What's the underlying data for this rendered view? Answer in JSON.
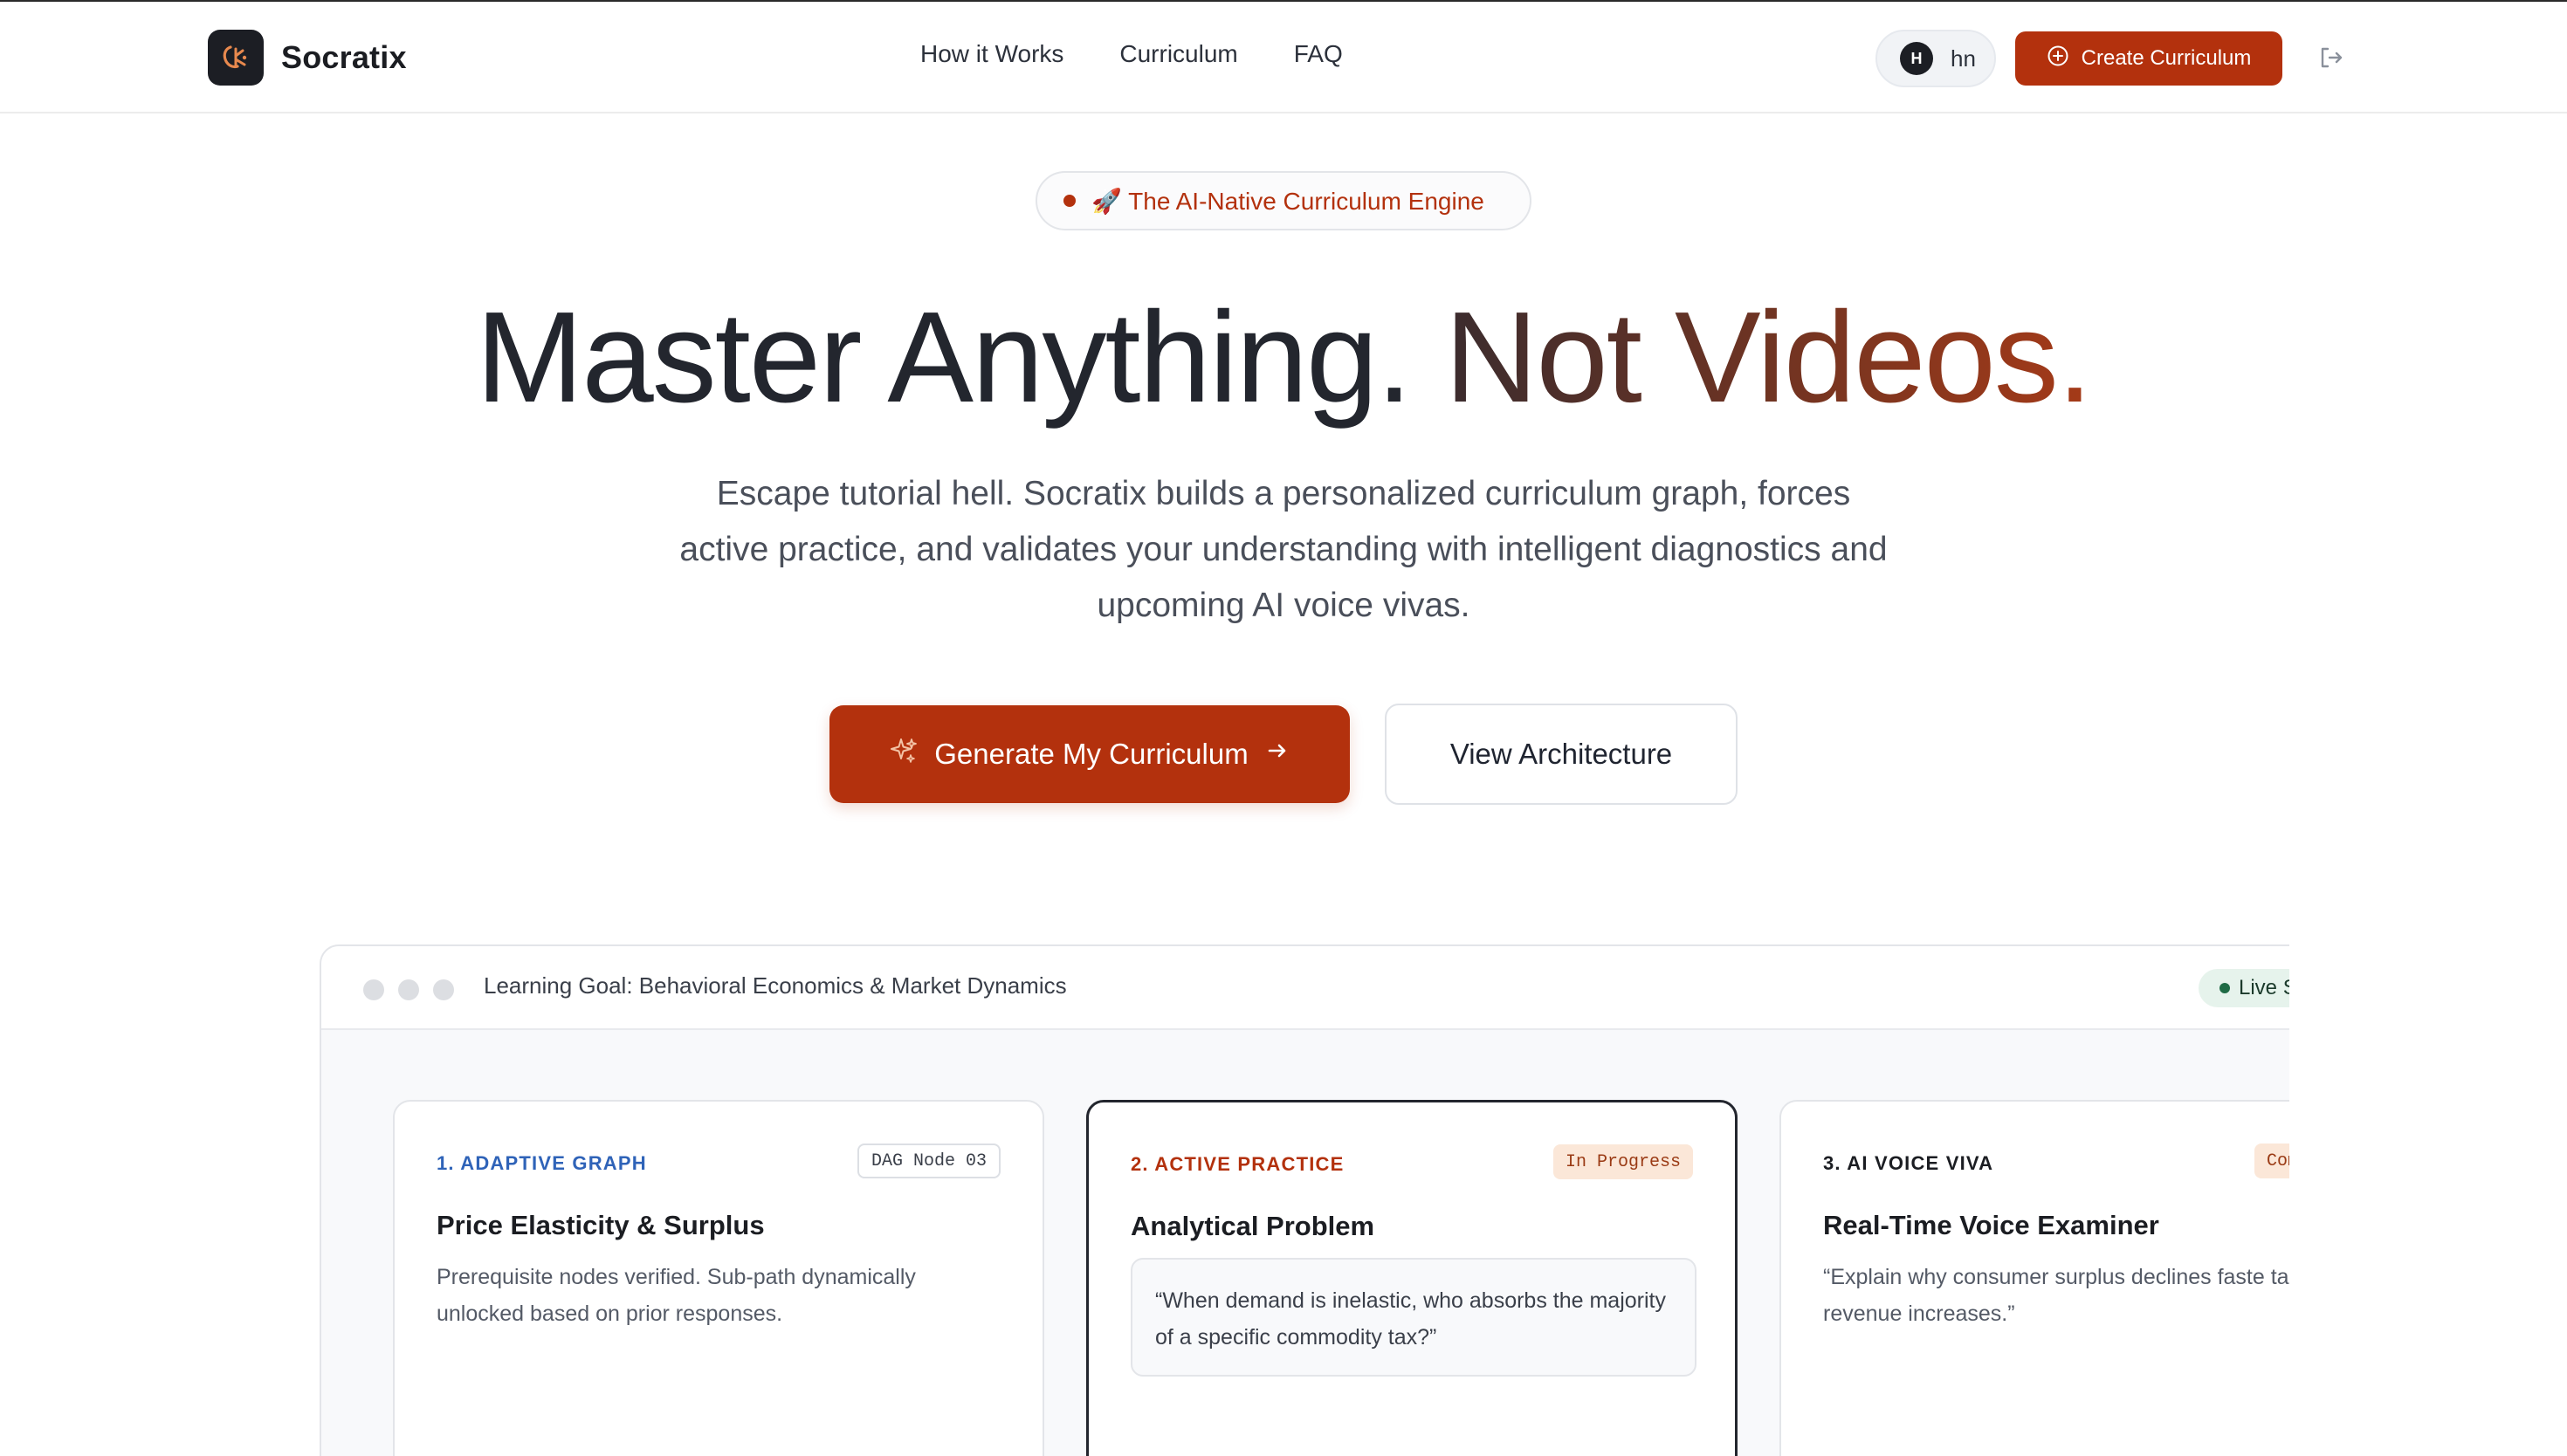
{
  "header": {
    "brand": "Socratix",
    "nav": [
      "How it Works",
      "Curriculum",
      "FAQ"
    ],
    "user": {
      "initial": "H",
      "name": "hn"
    },
    "create_label": "Create Curriculum"
  },
  "hero": {
    "badge": "🚀 The AI-Native Curriculum Engine",
    "headline_part1": "Master Anything.",
    "headline_part2": "Not Videos.",
    "subtitle": "Escape tutorial hell. Socratix builds a personalized curriculum graph, forces active practice, and validates your understanding with intelligent diagnostics and upcoming AI voice vivas.",
    "cta_primary": "Generate My Curriculum",
    "cta_secondary": "View Architecture"
  },
  "demo": {
    "title": "Learning Goal: Behavioral Economics & Market Dynamics",
    "live_label": "Live S",
    "cards": [
      {
        "tag": "1. ADAPTIVE GRAPH",
        "chip": "DAG Node 03",
        "title": "Price Elasticity & Surplus",
        "desc": "Prerequisite nodes verified. Sub-path dynamically unlocked based on prior responses."
      },
      {
        "tag": "2. ACTIVE PRACTICE",
        "chip": "In Progress",
        "title": "Analytical Problem",
        "quote": "“When demand is inelastic, who absorbs the majority of a specific commodity tax?”"
      },
      {
        "tag": "3. AI VOICE VIVA",
        "chip": "Com",
        "title": "Real-Time Voice Examiner",
        "desc": "“Explain why consumer surplus declines faste tax revenue increases.”"
      }
    ]
  },
  "colors": {
    "accent": "#b3310d",
    "dark": "#1c1e24",
    "tag_blue": "#2f63b8",
    "live_green": "#1f6b45"
  },
  "icons": [
    "brand-logo-icon",
    "user-avatar",
    "plus-circle-icon",
    "logout-icon",
    "sparkle-icon",
    "arrow-right-icon"
  ]
}
